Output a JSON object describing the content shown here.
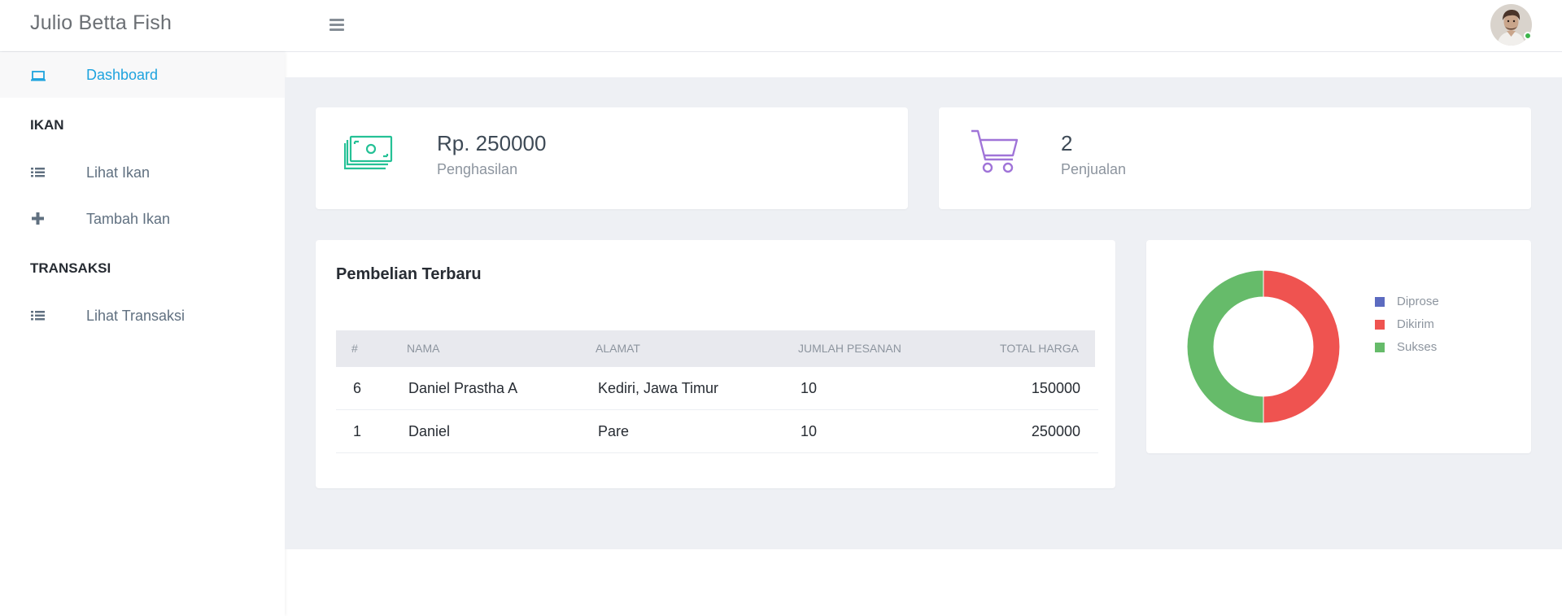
{
  "header": {
    "brand": "Julio Betta Fish",
    "menu_icon": "hamburger-icon",
    "avatar_icon": "user-avatar",
    "online_color": "#3cb44b"
  },
  "sidebar": {
    "items": [
      {
        "label": "Dashboard",
        "icon": "laptop-icon",
        "active": true
      },
      {
        "label": "Lihat Ikan",
        "icon": "list-icon"
      },
      {
        "label": "Tambah Ikan",
        "icon": "plus-icon"
      },
      {
        "label": "Lihat Transaksi",
        "icon": "list-icon"
      }
    ],
    "sections": [
      "IKAN",
      "TRANSAKSI"
    ]
  },
  "stats": [
    {
      "value": "Rp. 250000",
      "label": "Penghasilan",
      "icon": "money-icon",
      "color": "#25c196"
    },
    {
      "value": "2",
      "label": "Penjualan",
      "icon": "cart-icon",
      "color": "#a074d8"
    }
  ],
  "table": {
    "title": "Pembelian Terbaru",
    "headers": [
      "#",
      "NAMA",
      "ALAMAT",
      "JUMLAH PESANAN",
      "TOTAL HARGA"
    ],
    "rows": [
      [
        "6",
        "Daniel Prastha A",
        "Kediri, Jawa Timur",
        "10",
        "150000"
      ],
      [
        "1",
        "Daniel",
        "Pare",
        "10",
        "250000"
      ]
    ]
  },
  "chart_data": {
    "type": "pie",
    "categories": [
      "Diprose",
      "Dikirim",
      "Sukses"
    ],
    "values": [
      0,
      1,
      1
    ],
    "colors": [
      "#5c6bc0",
      "#ef5350",
      "#66bb6a"
    ],
    "legend": "right"
  }
}
